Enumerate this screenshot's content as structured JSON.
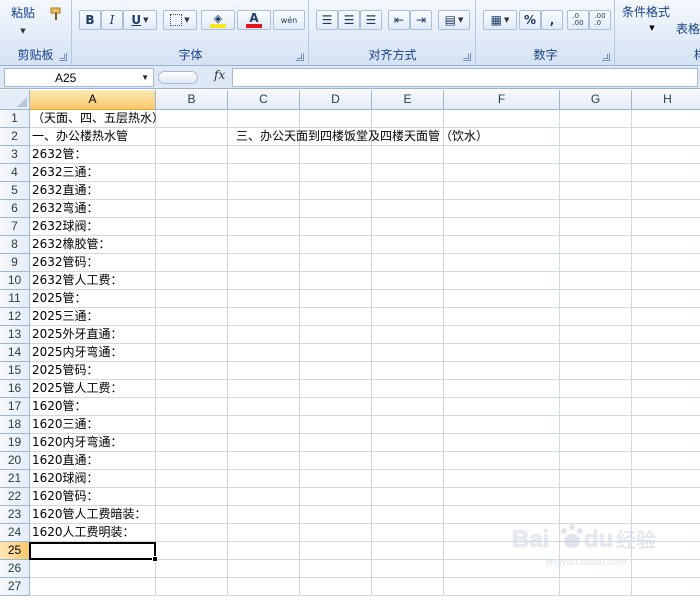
{
  "ribbon": {
    "clipboard": {
      "paste_label": "粘贴",
      "group_label": "剪贴板"
    },
    "font": {
      "bold": "B",
      "italic": "I",
      "underline": "U",
      "font_color_glyph": "A",
      "phonetic_glyph": "wén",
      "group_label": "字体"
    },
    "alignment": {
      "group_label": "对齐方式"
    },
    "number": {
      "percent": "%",
      "comma": ",",
      "increase_decimal": "←.0 .00",
      "decrease_decimal": ".00 →.0",
      "group_label": "数字"
    },
    "styles": {
      "conditional_format": "条件格式",
      "table_format": "表格",
      "group_label": "样"
    },
    "colors": {
      "fill": "#f7e61b",
      "font": "#e8141c"
    }
  },
  "formula_bar": {
    "name_box": "A25",
    "fx": "fx",
    "formula": ""
  },
  "columns": [
    "A",
    "B",
    "C",
    "D",
    "E",
    "F",
    "G",
    "H"
  ],
  "active_cell": {
    "column": "A",
    "row": "25"
  },
  "rows": [
    {
      "num": "1",
      "a": "（天面、四、五层热水）",
      "c": ""
    },
    {
      "num": "2",
      "a": "一、办公楼热水管",
      "c": "三、办公天面到四楼饭堂及四楼天面管（饮水）"
    },
    {
      "num": "3",
      "a": "2632管："
    },
    {
      "num": "4",
      "a": "2632三通："
    },
    {
      "num": "5",
      "a": "2632直通："
    },
    {
      "num": "6",
      "a": "2632弯通："
    },
    {
      "num": "7",
      "a": "2632球阀："
    },
    {
      "num": "8",
      "a": "2632橡胶管："
    },
    {
      "num": "9",
      "a": "2632管码："
    },
    {
      "num": "10",
      "a": "2632管人工费："
    },
    {
      "num": "11",
      "a": "2025管："
    },
    {
      "num": "12",
      "a": "2025三通："
    },
    {
      "num": "13",
      "a": "2025外牙直通："
    },
    {
      "num": "14",
      "a": "2025内牙弯通："
    },
    {
      "num": "15",
      "a": "2025管码："
    },
    {
      "num": "16",
      "a": "2025管人工费："
    },
    {
      "num": "17",
      "a": "1620管："
    },
    {
      "num": "18",
      "a": "1620三通："
    },
    {
      "num": "19",
      "a": "1620内牙弯通："
    },
    {
      "num": "20",
      "a": "1620直通："
    },
    {
      "num": "21",
      "a": "1620球阀："
    },
    {
      "num": "22",
      "a": "1620管码："
    },
    {
      "num": "23",
      "a": "1620管人工费暗装："
    },
    {
      "num": "24",
      "a": "1620人工费明装："
    },
    {
      "num": "25",
      "a": ""
    },
    {
      "num": "26",
      "a": ""
    },
    {
      "num": "27",
      "a": ""
    }
  ],
  "watermark": {
    "brand": "Baidu",
    "brand_cn": "经验",
    "site": "jingyan.baidu.com"
  }
}
